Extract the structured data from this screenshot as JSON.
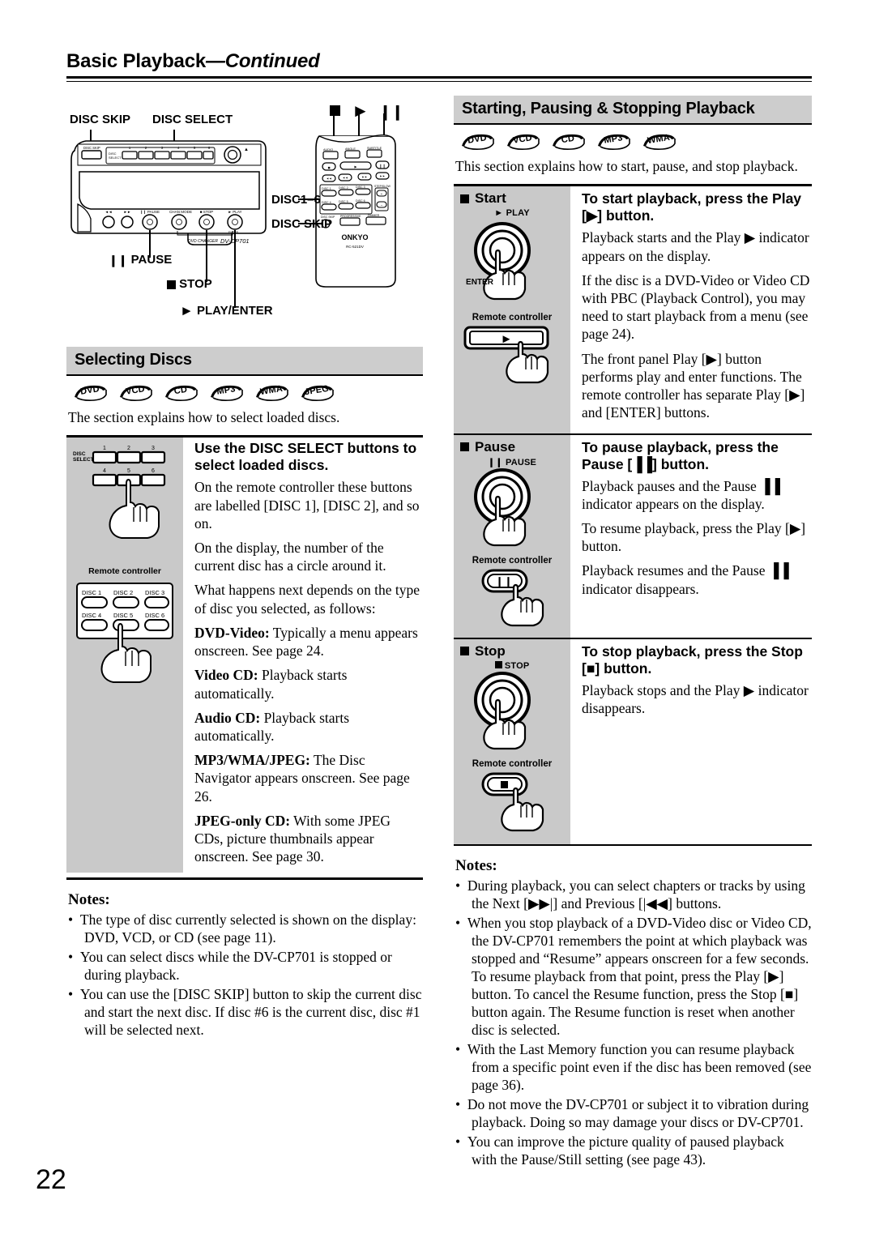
{
  "page": {
    "folio": "22",
    "running_head_main": "Basic Playback",
    "running_head_cont": "—Continued"
  },
  "front_panel_callouts": {
    "disc_skip_top": "DISC SKIP",
    "disc_select_top": "DISC SELECT",
    "pause": "PAUSE",
    "stop": "STOP",
    "play_enter": "PLAY/ENTER",
    "disc1_6": "DISC1–6",
    "disc_skip_remote": "DISC SKIP",
    "panel_brand": "ONKYO",
    "panel_model": "DVD CHANGER   DV-CP701",
    "remote_model": "RC-521DV",
    "panel_button_labels": [
      "DISC SKIP",
      "DISC SELECT",
      "PAUSE",
      "CHAN MODE",
      "STOP",
      "PLAY"
    ],
    "panel_disc_numbers": [
      "1",
      "2",
      "3",
      "4",
      "5",
      "6"
    ],
    "remote_top_labels": [
      "AUDIO",
      "ANGLE",
      "SUBTITLE"
    ],
    "remote_disc_labels": [
      "DISC 1",
      "DISC 2",
      "DISC 3",
      "DISC 4",
      "DISC 5",
      "DISC 6"
    ],
    "remote_bottom_labels": [
      "DISC SKIP",
      "PROGRESSIVE",
      "DIMMER"
    ],
    "remote_step_label": "STEP/SLOW"
  },
  "selecting_discs": {
    "heading": "Selecting Discs",
    "media_badges": [
      "DVD",
      "VCD",
      "CD",
      "MP3",
      "WMA",
      "JPEG"
    ],
    "intro": "The section explains how to select loaded discs.",
    "subhead": "Use the DISC SELECT buttons to select loaded discs.",
    "paragraphs": [
      "On the remote controller these buttons are labelled [DISC 1], [DISC 2], and so on.",
      "On the display, the number of the current disc has a circle around it.",
      "What happens next depends on the type of disc you selected, as follows:"
    ],
    "disc_types": [
      {
        "term": "DVD-Video:",
        "text": " Typically a menu appears onscreen. See page 24."
      },
      {
        "term": "Video CD:",
        "text": " Playback starts automatically."
      },
      {
        "term": "Audio CD:",
        "text": " Playback starts automatically."
      },
      {
        "term": "MP3/WMA/JPEG:",
        "text": " The Disc Navigator appears onscreen. See page 26."
      },
      {
        "term": "JPEG-only CD:",
        "text": " With some JPEG CDs, picture thumbnails appear onscreen. See page 30."
      }
    ],
    "art": {
      "disc_select_label": "DISC SELECT",
      "disc_numbers": [
        "1",
        "2",
        "3",
        "4",
        "5",
        "6"
      ],
      "remote_caption": "Remote controller",
      "remote_buttons": [
        "DISC 1",
        "DISC 2",
        "DISC 3",
        "DISC 4",
        "DISC 5",
        "DISC 6"
      ]
    },
    "notes_title": "Notes:",
    "notes": [
      "The type of disc currently selected is shown on the display: DVD, VCD, or CD (see page 11).",
      "You can select discs while the DV-CP701 is stopped or during playback.",
      "You can use the [DISC SKIP] button to skip the current disc and start the next disc. If disc #6 is the current disc, disc #1 will be selected next."
    ]
  },
  "starting_pausing_stopping": {
    "heading": "Starting, Pausing & Stopping Playback",
    "media_badges": [
      "DVD",
      "VCD",
      "CD",
      "MP3",
      "WMA"
    ],
    "intro": "This section explains how to start, pause, and stop playback.",
    "steps": [
      {
        "label": "Start",
        "button_caption": "PLAY",
        "button_sub_caption": "ENTER",
        "remote_caption": "Remote controller",
        "subhead": "To start playback, press the Play [▶] button.",
        "paragraphs": [
          "Playback starts and the Play ▶ indicator appears on the display.",
          "If the disc is a DVD-Video or Video CD with PBC (Playback Control), you may need to start playback from a menu (see page 24).",
          "The front panel Play [▶] button performs play and enter functions. The remote controller has separate Play [▶] and [ENTER] buttons."
        ]
      },
      {
        "label": "Pause",
        "button_caption": "PAUSE",
        "button_sub_caption": "",
        "remote_caption": "Remote controller",
        "subhead": "To pause playback, press the Pause [▐▐] button.",
        "paragraphs": [
          "Playback pauses and the Pause ▐▐ indicator appears on the display.",
          "To resume playback, press the Play [▶] button.",
          "Playback resumes and the Pause ▐▐ indicator disappears."
        ]
      },
      {
        "label": "Stop",
        "button_caption": "STOP",
        "button_sub_caption": "",
        "remote_caption": "Remote controller",
        "subhead": "To stop playback, press the Stop [■] button.",
        "paragraphs": [
          "Playback stops and the Play ▶ indicator disappears."
        ]
      }
    ],
    "notes_title": "Notes:",
    "notes": [
      "During playback, you can select chapters or tracks by using the Next [▶▶|] and Previous [|◀◀] buttons.",
      "When you stop playback of a DVD-Video disc or Video CD, the DV-CP701 remembers the point at which playback was stopped and “Resume” appears onscreen for a few seconds. To resume playback from that point, press the Play [▶] button. To cancel the Resume function, press the Stop [■] button again. The Resume function is reset when another disc is selected.",
      "With the Last Memory function you can resume playback from a specific point even if the disc has been removed (see page 36).",
      "Do not move the DV-CP701 or subject it to vibration during playback. Doing so may damage your discs or DV-CP701.",
      "You can improve the picture quality of paused playback with the Pause/Still setting (see page 43)."
    ]
  },
  "colors": {
    "section_bar": "#cdcdcd",
    "art_panel": "#c9c9c9",
    "rule": "#000000"
  }
}
